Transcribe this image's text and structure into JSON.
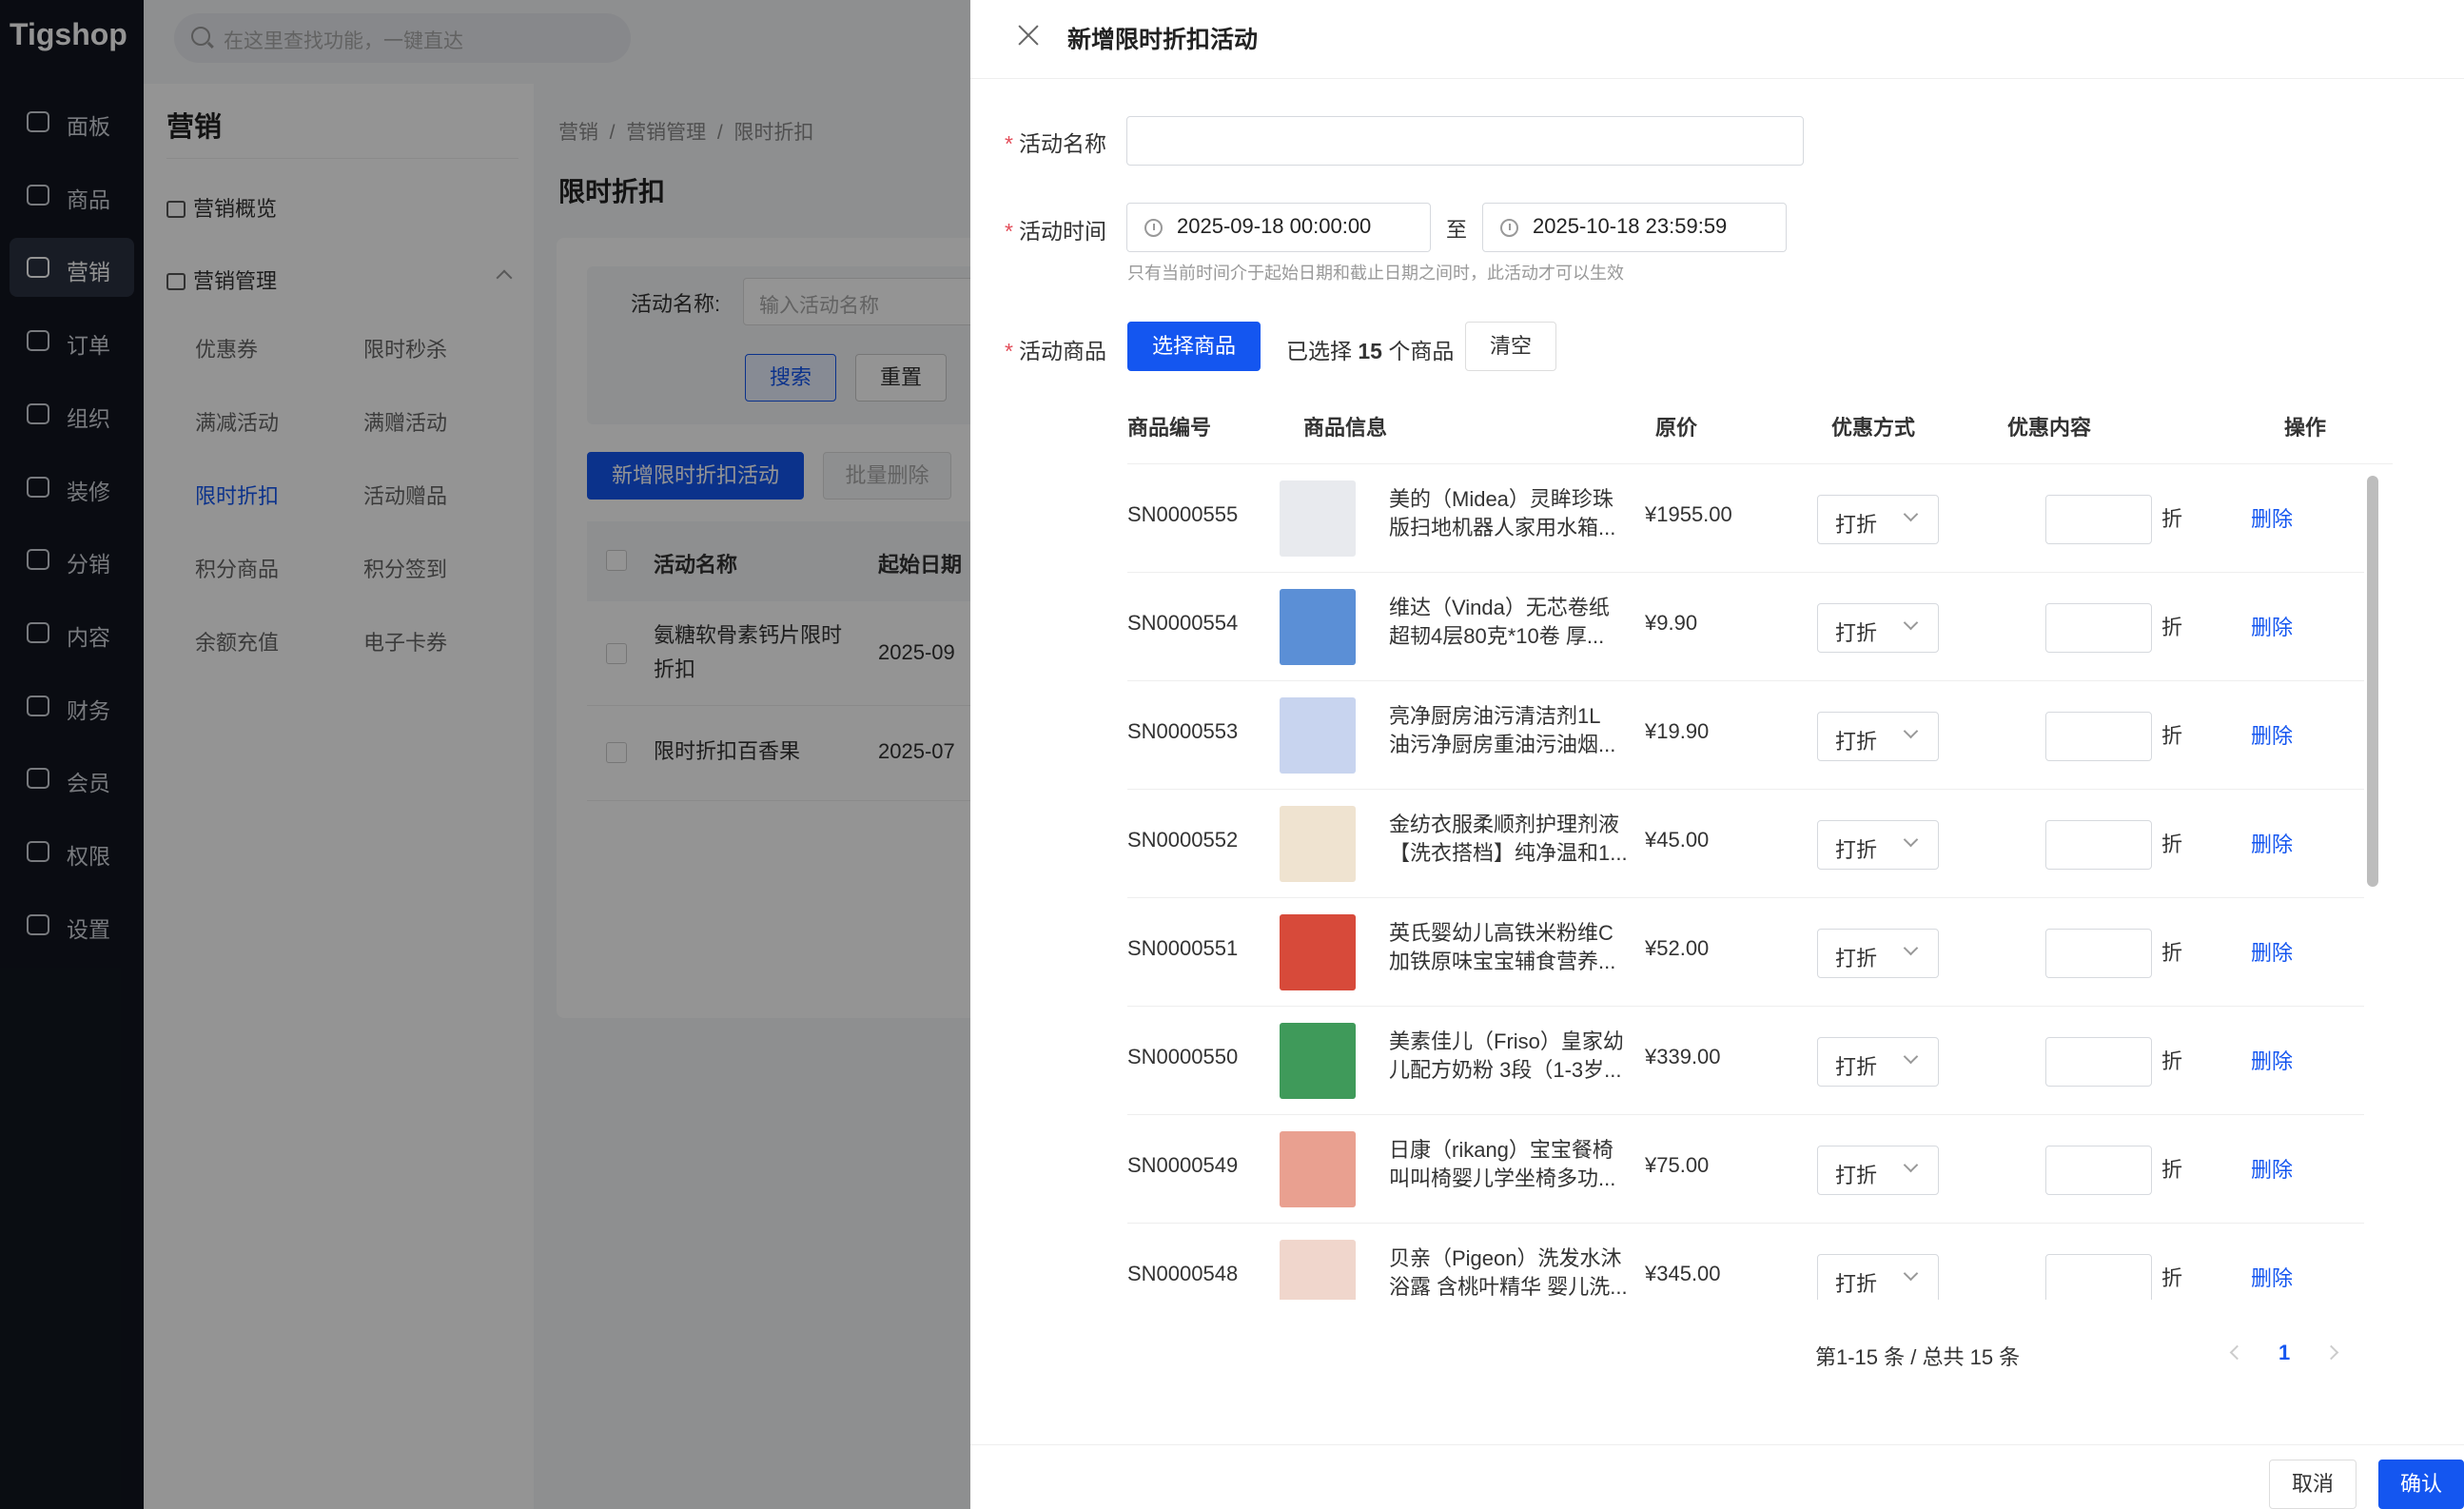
{
  "app": {
    "logo": "Tigshop",
    "search_placeholder": "在这里查找功能，一键直达"
  },
  "nav": [
    {
      "label": "面板",
      "icon": "dashboard-icon"
    },
    {
      "label": "商品",
      "icon": "box-icon"
    },
    {
      "label": "营销",
      "icon": "marketing-icon",
      "active": true
    },
    {
      "label": "订单",
      "icon": "order-icon"
    },
    {
      "label": "组织",
      "icon": "organization-icon"
    },
    {
      "label": "装修",
      "icon": "decoration-icon"
    },
    {
      "label": "分销",
      "icon": "distribution-icon"
    },
    {
      "label": "内容",
      "icon": "content-icon"
    },
    {
      "label": "财务",
      "icon": "finance-icon"
    },
    {
      "label": "会员",
      "icon": "member-icon"
    },
    {
      "label": "权限",
      "icon": "permission-icon"
    },
    {
      "label": "设置",
      "icon": "settings-icon"
    }
  ],
  "submenu": {
    "title": "营销",
    "overview": "营销概览",
    "group": "营销管理",
    "links": [
      "优惠券",
      "限时秒杀",
      "满减活动",
      "满赠活动",
      "限时折扣",
      "活动赠品",
      "积分商品",
      "积分签到",
      "余额充值",
      "电子卡券"
    ]
  },
  "main": {
    "breadcrumb": [
      "营销",
      "营销管理",
      "限时折扣"
    ],
    "title": "限时折扣",
    "filter_label": "活动名称:",
    "filter_placeholder": "输入活动名称",
    "search_btn": "搜索",
    "reset_btn": "重置",
    "add_btn": "新增限时折扣活动",
    "batch_delete_btn": "批量删除",
    "columns": [
      "活动名称",
      "起始日期"
    ],
    "rows": [
      {
        "name_line1": "氨糖软骨素钙片限时",
        "name_line2": "折扣",
        "date": "2025-09"
      },
      {
        "name_line1": "限时折扣百香果",
        "name_line2": "",
        "date": "2025-07"
      }
    ]
  },
  "drawer": {
    "title": "新增限时折扣活动",
    "name_label": "活动名称",
    "name_value": "",
    "time_label": "活动时间",
    "start_time": "2025-09-18 00:00:00",
    "to": "至",
    "end_time": "2025-10-18 23:59:59",
    "time_help": "只有当前时间介于起始日期和截止日期之间时，此活动才可以生效",
    "goods_label": "活动商品",
    "select_btn": "选择商品",
    "selected_prefix": "已选择",
    "selected_count": "15",
    "selected_suffix": "个商品",
    "clear_btn": "清空",
    "columns": [
      "商品编号",
      "商品信息",
      "原价",
      "优惠方式",
      "优惠内容",
      "操作"
    ],
    "discount_unit": "折",
    "delete_label": "删除",
    "products": [
      {
        "sn": "SN0000555",
        "name1": "美的（Midea）灵眸珍珠",
        "name2": "版扫地机器人家用水箱...",
        "price": "¥1955.00",
        "method": "打折",
        "color": "#e8eaee"
      },
      {
        "sn": "SN0000554",
        "name1": "维达（Vinda）无芯卷纸",
        "name2": "超韧4层80克*10卷 厚...",
        "price": "¥9.90",
        "method": "打折",
        "color": "#5b8fd6"
      },
      {
        "sn": "SN0000553",
        "name1": "亮净厨房油污清洁剂1L",
        "name2": "油污净厨房重油污油烟...",
        "price": "¥19.90",
        "method": "打折",
        "color": "#c8d4ef"
      },
      {
        "sn": "SN0000552",
        "name1": "金纺衣服柔顺剂护理剂液",
        "name2": "【洗衣搭档】纯净温和1...",
        "price": "¥45.00",
        "method": "打折",
        "color": "#efe3d0"
      },
      {
        "sn": "SN0000551",
        "name1": "英氏婴幼儿高铁米粉维C",
        "name2": "加铁原味宝宝辅食营养...",
        "price": "¥52.00",
        "method": "打折",
        "color": "#d74a3a"
      },
      {
        "sn": "SN0000550",
        "name1": "美素佳儿（Friso）皇家幼",
        "name2": "儿配方奶粉 3段（1-3岁...",
        "price": "¥339.00",
        "method": "打折",
        "color": "#3f9a5a"
      },
      {
        "sn": "SN0000549",
        "name1": "日康（rikang）宝宝餐椅",
        "name2": "叫叫椅婴儿学坐椅多功...",
        "price": "¥75.00",
        "method": "打折",
        "color": "#e9a090"
      },
      {
        "sn": "SN0000548",
        "name1": "贝亲（Pigeon）洗发水沐",
        "name2": "浴露 含桃叶精华 婴儿洗...",
        "price": "¥345.00",
        "method": "打折",
        "color": "#f0d6cc"
      }
    ],
    "pager_text": "第1-15 条 / 总共 15 条",
    "page": "1",
    "cancel_btn": "取消",
    "confirm_btn": "确认"
  }
}
